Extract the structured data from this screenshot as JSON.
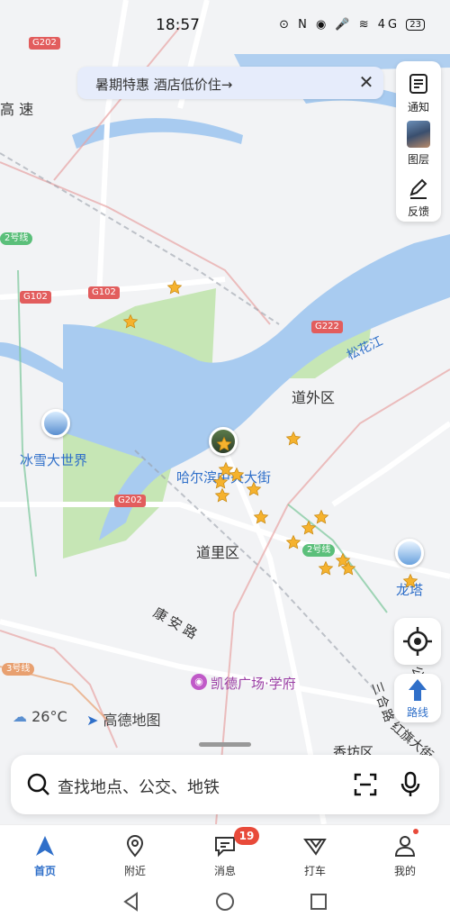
{
  "status_bar": {
    "time": "18:57",
    "icons_text": "⊙ N ◉ 🎤 ≋ 4G",
    "battery": "23"
  },
  "banner": {
    "text": "暑期特惠 酒店低价住→"
  },
  "tools": [
    {
      "label": "通知",
      "icon": "notification-icon"
    },
    {
      "label": "图层",
      "icon": "layers-avatar"
    },
    {
      "label": "反馈",
      "icon": "feedback-pen-icon"
    }
  ],
  "map_labels": {
    "top_road": "G202",
    "g102_left": "G102",
    "g102_mid": "G102",
    "g222": "G222",
    "g202_bottom": "G202",
    "line2_left": "2号线",
    "line2_mid": "2号线",
    "line3": "3号线",
    "expressway_fragment": "高 速",
    "river": "松花江",
    "daowai": "道外区",
    "daoli": "道里区",
    "ice_snow": "冰雪大世界",
    "central_street": "哈尔滨中央大街",
    "dragon_tower": "龙塔",
    "anan_road": "康安路",
    "kaide": "凯德广场·学府",
    "sanhuan": "三环公滨",
    "hongqi": "红旗大街",
    "sanhe": "三合路",
    "xiangfang": "香坊区"
  },
  "weather": {
    "temp": "26°C"
  },
  "brand": "高德地图",
  "route_label": "路线",
  "search": {
    "placeholder": "查找地点、公交、地铁"
  },
  "nav": [
    {
      "label": "首页",
      "icon": "home-arrow-icon",
      "active": true
    },
    {
      "label": "附近",
      "icon": "nearby-pin-icon",
      "active": false
    },
    {
      "label": "消息",
      "icon": "message-icon",
      "active": false
    },
    {
      "label": "打车",
      "icon": "taxi-icon",
      "active": false
    },
    {
      "label": "我的",
      "icon": "profile-icon",
      "active": false
    }
  ],
  "message_badge": "19",
  "colors": {
    "accent": "#2f6fc9",
    "water": "#a8cbf0",
    "park": "#bfe3ae",
    "star": "#f5b22e",
    "badge": "#e84a3a"
  }
}
